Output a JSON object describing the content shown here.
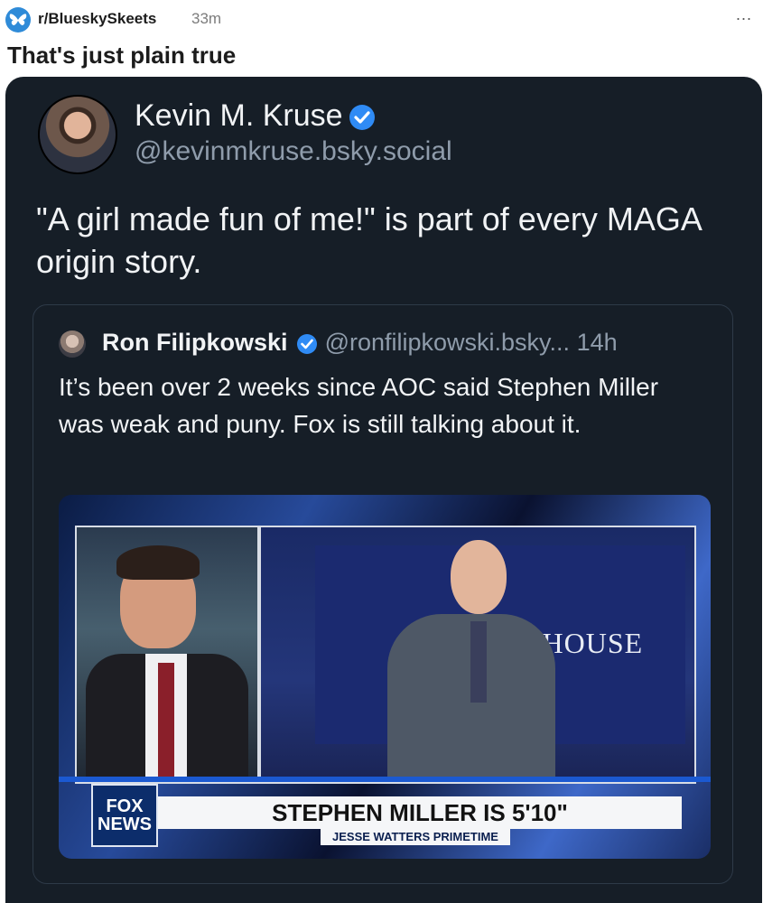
{
  "header": {
    "subreddit": "r/BlueskySkeets",
    "age": "33m",
    "more_label": "...",
    "title": "That's just plain true"
  },
  "post": {
    "author_name": "Kevin M. Kruse",
    "author_handle": "@kevinmkruse.bsky.social",
    "verified": true,
    "text": "\"A girl made fun of me!\" is part of every MAGA origin story."
  },
  "quote": {
    "author_name": "Ron Filipkowski",
    "author_handle": "@ronfilipkowski.bsky...",
    "age": "14h",
    "verified": true,
    "text": "It’s been over 2 weeks since AOC said Stephen Miller was weak and puny. Fox is still talking about it."
  },
  "media": {
    "sign_text": "E HOUSE",
    "logo_line1": "FOX",
    "logo_line2": "NEWS",
    "chyron": "STEPHEN MILLER IS 5'10\"",
    "show_name": "JESSE WATTERS PRIMETIME"
  },
  "colors": {
    "card_bg": "#161e27",
    "verified_blue": "#2f8bf5",
    "handle_gray": "#8f9cab"
  }
}
